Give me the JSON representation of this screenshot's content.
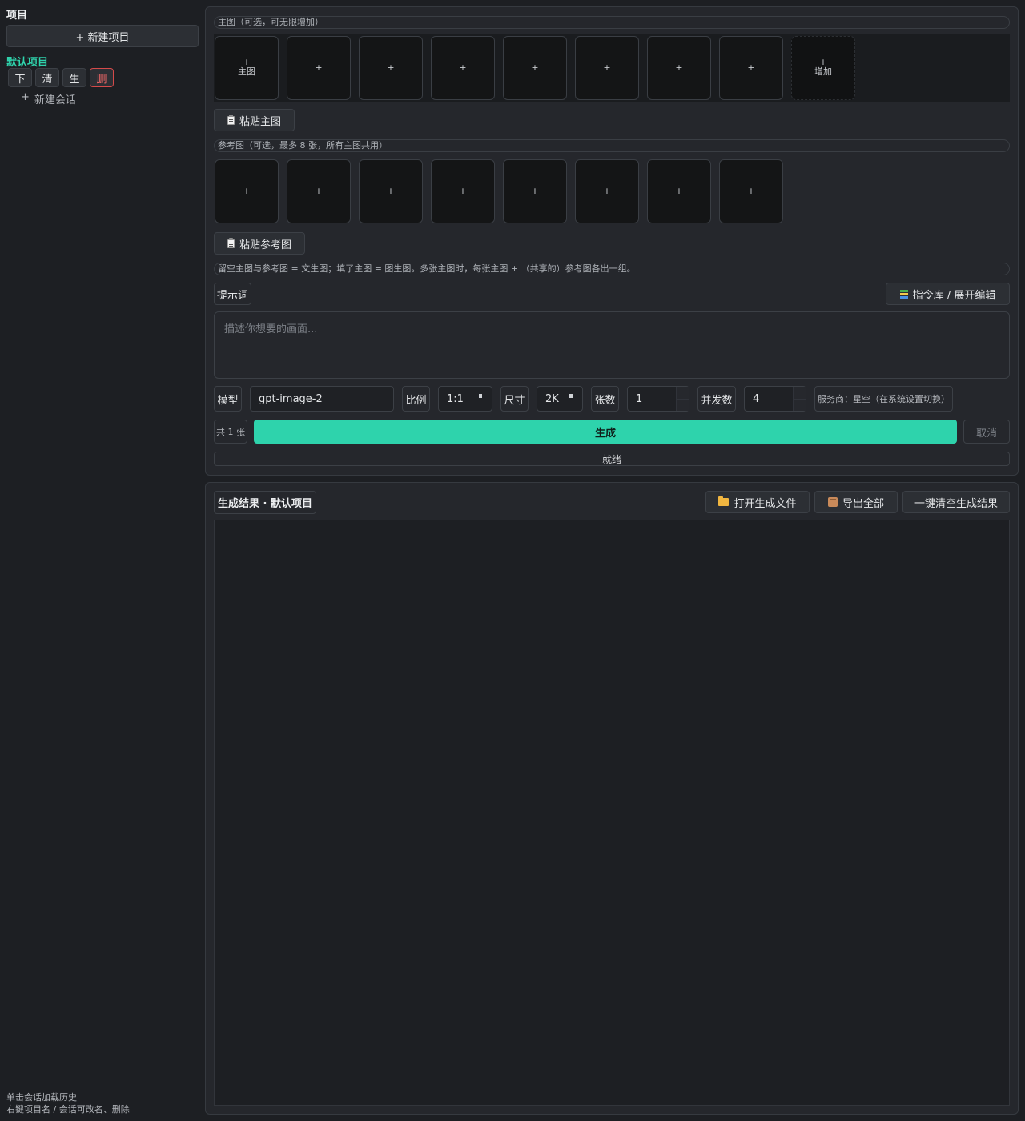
{
  "sidebar": {
    "title": "项目",
    "new_project": "+ 新建项目",
    "project_name": "默认项目",
    "actions": [
      "下",
      "清",
      "生",
      "删"
    ],
    "new_session_plus": "+",
    "new_session": "新建会话",
    "hint_line1": "单击会话加载历史",
    "hint_line2": "右键项目名 / 会话可改名、删除"
  },
  "main_images": {
    "label": "主图（可选，可无限增加）",
    "slot_plus": "+",
    "first_slot_text": "主图",
    "add_slot_text": "增加",
    "paste_button": "粘贴主图"
  },
  "ref_images": {
    "label": "参考图（可选，最多 8 张，所有主图共用）",
    "slot_plus": "+",
    "paste_button": "粘贴参考图"
  },
  "info_text": "留空主图与参考图 = 文生图；填了主图 = 图生图。多张主图时，每张主图 + （共享的）参考图各出一组。",
  "prompt": {
    "label": "提示词",
    "library_button": "指令库 / 展开编辑",
    "placeholder": "描述你想要的画面..."
  },
  "settings": {
    "model_label": "模型",
    "model_value": "gpt-image-2",
    "ratio_label": "比例",
    "ratio_value": "1:1",
    "size_label": "尺寸",
    "size_value": "2K",
    "count_label": "张数",
    "count_value": "1",
    "concurrency_label": "并发数",
    "concurrency_value": "4",
    "provider": "服务商：星空（在系统设置切换）"
  },
  "actions": {
    "total": "共 1 张",
    "generate": "生成",
    "cancel": "取消",
    "status": "就绪"
  },
  "results": {
    "title": "生成结果 · 默认项目",
    "open_files": "打开生成文件",
    "export_all": "导出全部",
    "clear_all": "一键清空生成结果"
  },
  "colors": {
    "accent": "#2ed3ac",
    "danger": "#ff6b6b",
    "background": "#1d1f23"
  }
}
